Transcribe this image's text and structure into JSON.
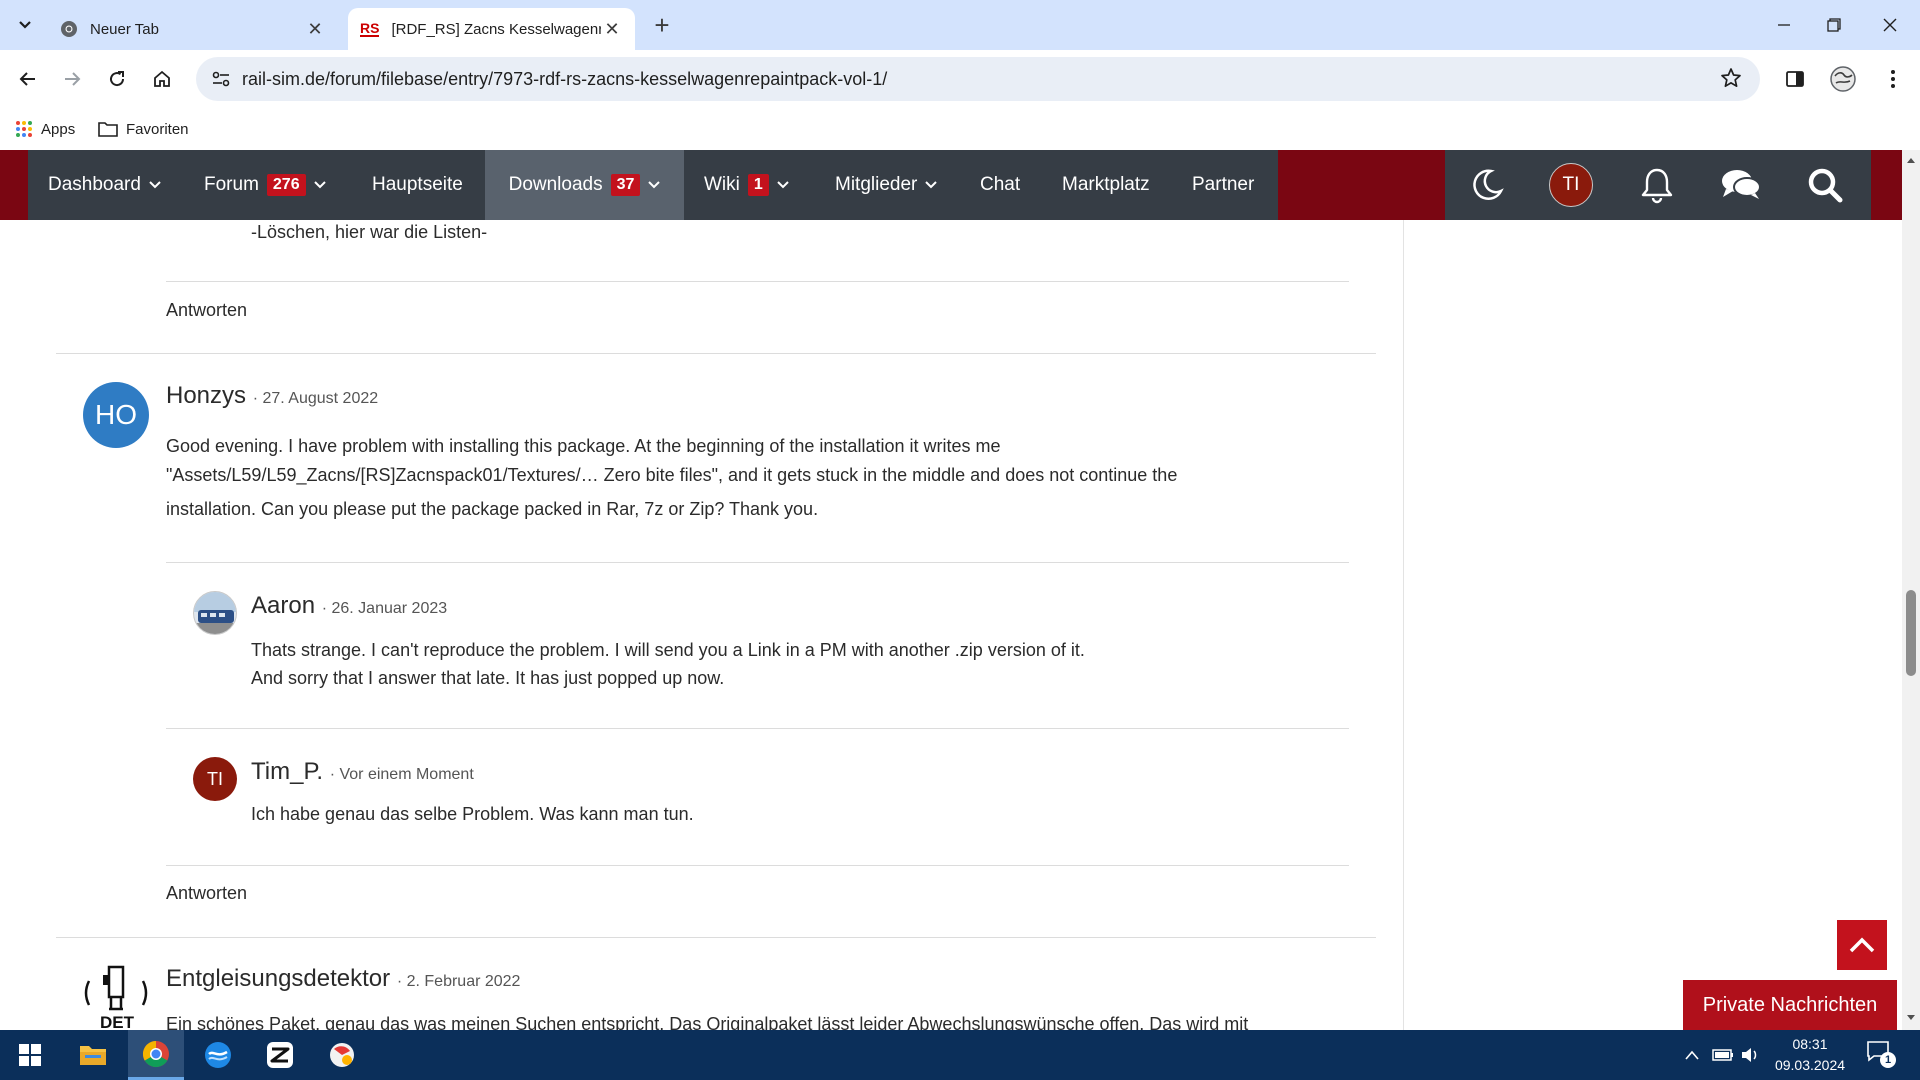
{
  "browser": {
    "tabs": [
      {
        "title": "Neuer Tab",
        "active": false
      },
      {
        "title": "[RDF_RS] Zacns Kesselwagenrep",
        "favicon_text": "RS",
        "active": true
      }
    ],
    "url": "rail-sim.de/forum/filebase/entry/7973-rdf-rs-zacns-kesselwagenrepaintpack-vol-1/",
    "bookmarks": [
      {
        "label": "Apps",
        "icon": "apps-grid-icon"
      },
      {
        "label": "Favoriten",
        "icon": "folder-icon"
      }
    ]
  },
  "nav": {
    "items": [
      {
        "label": "Dashboard",
        "dropdown": true
      },
      {
        "label": "Forum",
        "badge": "276",
        "dropdown": true
      },
      {
        "label": "Hauptseite"
      },
      {
        "label": "Downloads",
        "badge": "37",
        "dropdown": true,
        "active": true
      },
      {
        "label": "Wiki",
        "badge": "1",
        "dropdown": true
      },
      {
        "label": "Mitglieder",
        "dropdown": true
      },
      {
        "label": "Chat"
      },
      {
        "label": "Marktplatz"
      },
      {
        "label": "Partner"
      }
    ],
    "user_initials": "TI"
  },
  "comments": {
    "prev_line": "-Löschen, hier war die Listen-",
    "reply_label": "Antworten",
    "honzys": {
      "avatar": "HO",
      "author": "Honzys",
      "date": "· 27. August 2022",
      "lines": [
        "Good evening. I have problem with installing this package. At the beginning of the installation it writes me",
        "\"Assets/L59/L59_Zacns/[RS]Zacnspack01/Textures/… Zero bite files\", and it gets stuck in the middle and does not continue the",
        "installation. Can you please put the package packed in Rar, 7z or Zip? Thank you."
      ]
    },
    "aaron": {
      "author": "Aaron",
      "date": "· 26. Januar 2023",
      "lines": [
        "Thats strange. I can't reproduce the problem. I will send you a Link in a PM with another .zip version of it.",
        "And sorry that I answer that late. It has just popped up now."
      ]
    },
    "tim": {
      "avatar": "TI",
      "author": "Tim_P.",
      "date": "· Vor einem Moment",
      "lines": [
        "Ich habe genau das selbe Problem. Was kann man tun."
      ]
    },
    "entgleisung": {
      "avatar_text": "DET",
      "author": "Entgleisungsdetektor",
      "date": "· 2. Februar 2022",
      "line": "Ein schönes Paket, genau das was meinen Suchen entspricht. Das Originalpaket lässt leider Abwechslungswünsche offen. Das wird mit"
    }
  },
  "widgets": {
    "private_messages": "Private Nachrichten"
  },
  "taskbar": {
    "time": "08:31",
    "date": "09.03.2024",
    "notification_count": "1"
  },
  "colors": {
    "brand_red": "#7a0612",
    "nav_dark": "#363d45",
    "badge_red": "#c3121d",
    "avatar_blue": "#2f7cc4"
  }
}
